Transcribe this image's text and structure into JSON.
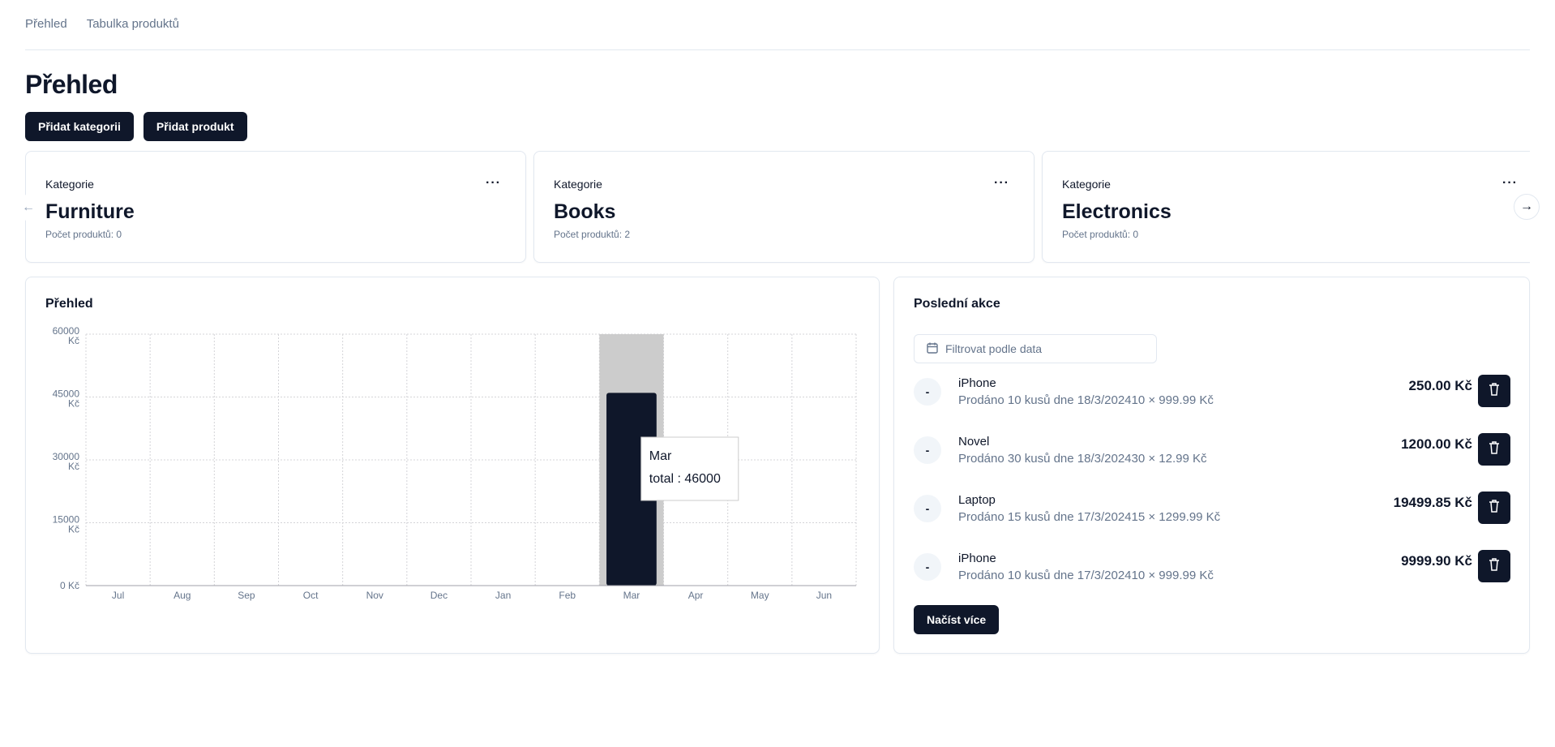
{
  "nav": {
    "items": [
      "Přehled",
      "Tabulka produktů"
    ]
  },
  "page": {
    "title": "Přehled"
  },
  "actions": {
    "add_category": "Přidat kategorii",
    "add_product": "Přidat produkt"
  },
  "categories": [
    {
      "label": "Kategorie",
      "name": "Furniture",
      "count": "Počet produktů: 0",
      "menu": "···"
    },
    {
      "label": "Kategorie",
      "name": "Books",
      "count": "Počet produktů: 2",
      "menu": "···"
    },
    {
      "label": "Kategorie",
      "name": "Electronics",
      "count": "Počet produktů: 0",
      "menu": "···"
    }
  ],
  "carousel": {
    "prev_icon": "←",
    "next_icon": "→"
  },
  "overview": {
    "title": "Přehled"
  },
  "chart_data": {
    "type": "bar",
    "title": "Přehled",
    "categories": [
      "Jul",
      "Aug",
      "Sep",
      "Oct",
      "Nov",
      "Dec",
      "Jan",
      "Feb",
      "Mar",
      "Apr",
      "May",
      "Jun"
    ],
    "series": [
      {
        "name": "total",
        "values": [
          0,
          0,
          0,
          0,
          0,
          0,
          0,
          0,
          46000,
          0,
          0,
          0
        ]
      }
    ],
    "ylim": [
      0,
      60000
    ],
    "yticks": [
      0,
      15000,
      30000,
      45000,
      60000
    ],
    "ytick_labels": [
      "0 Kč",
      "15000 Kč",
      "30000 Kč",
      "45000 Kč",
      "60000 Kč"
    ],
    "grid": true,
    "bar_color": "#0f172a",
    "hover_color": "#cccccc",
    "tooltip": {
      "category": "Mar",
      "text": "total : 46000"
    }
  },
  "recent": {
    "title": "Poslední akce",
    "filter_placeholder": "Filtrovat podle data",
    "items": [
      {
        "avatar": "-",
        "name": "iPhone",
        "desc": "Prodáno 10 kusů dne 18/3/202410 × 999.99 Kč",
        "amount": "250.00 Kč"
      },
      {
        "avatar": "-",
        "name": "Novel",
        "desc": "Prodáno 30 kusů dne 18/3/202430 × 12.99 Kč",
        "amount": "1200.00 Kč"
      },
      {
        "avatar": "-",
        "name": "Laptop",
        "desc": "Prodáno 15 kusů dne 17/3/202415 × 1299.99 Kč",
        "amount": "19499.85 Kč"
      },
      {
        "avatar": "-",
        "name": "iPhone",
        "desc": "Prodáno 10 kusů dne 17/3/202410 × 999.99 Kč",
        "amount": "9999.90 Kč"
      }
    ],
    "load_more": "Načíst více"
  },
  "icons": {
    "calendar": "calendar-icon",
    "trash": "trash-icon",
    "menu": "more-horizontal-icon"
  }
}
